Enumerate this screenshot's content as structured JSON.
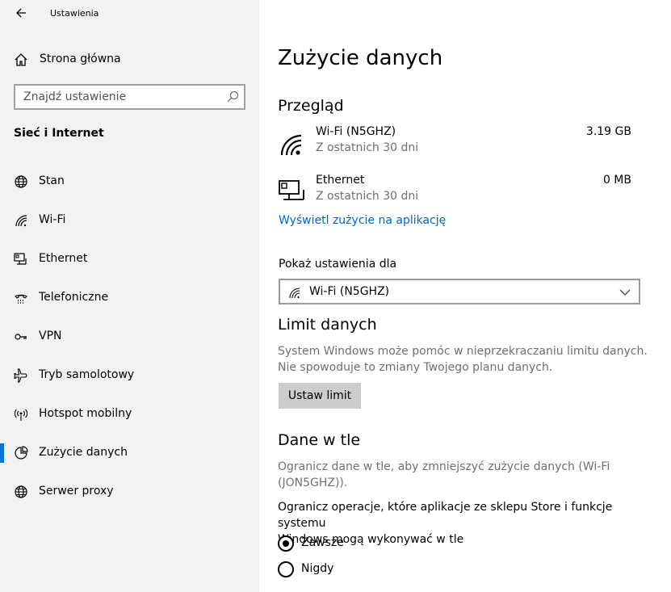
{
  "app": {
    "title": "Ustawienia"
  },
  "sidebar": {
    "home_label": "Strona główna",
    "search_placeholder": "Znajdź ustawienie",
    "section_title": "Sieć i Internet",
    "items": [
      {
        "label": "Stan",
        "icon": "globe-icon",
        "active": false
      },
      {
        "label": "Wi-Fi",
        "icon": "wifi-icon",
        "active": false
      },
      {
        "label": "Ethernet",
        "icon": "ethernet-icon",
        "active": false
      },
      {
        "label": "Telefoniczne",
        "icon": "dialup-icon",
        "active": false
      },
      {
        "label": "VPN",
        "icon": "vpn-icon",
        "active": false
      },
      {
        "label": "Tryb samolotowy",
        "icon": "airplane-icon",
        "active": false
      },
      {
        "label": "Hotspot mobilny",
        "icon": "hotspot-icon",
        "active": false
      },
      {
        "label": "Zużycie danych",
        "icon": "data-usage-icon",
        "active": true
      },
      {
        "label": "Serwer proxy",
        "icon": "globe-icon",
        "active": false
      }
    ]
  },
  "main": {
    "title": "Zużycie danych",
    "overview": {
      "heading": "Przegląd",
      "rows": [
        {
          "name": "Wi-Fi (N5GHZ)",
          "sub": "Z ostatnich 30 dni",
          "amount": "3.19 GB",
          "icon": "wifi-icon"
        },
        {
          "name": "Ethernet",
          "sub": "Z ostatnich 30 dni",
          "amount": "0 MB",
          "icon": "ethernet-icon"
        }
      ],
      "link": "Wyświetl zużycie na aplikację"
    },
    "show_settings": {
      "label": "Pokaż ustawienia dla",
      "selected": "Wi-Fi (N5GHZ)"
    },
    "limit": {
      "heading": "Limit danych",
      "desc_line1": "System Windows może pomóc w nieprzekraczaniu limitu danych.",
      "desc_line2": "Nie spowoduje to zmiany Twojego planu danych.",
      "button": "Ustaw limit"
    },
    "background": {
      "heading": "Dane w tle",
      "desc_line1": "Ogranicz dane w tle, aby zmniejszyć zużycie danych (Wi-Fi",
      "desc_line2": "(JON5GHZ)).",
      "text_line1": "Ogranicz operacje, które aplikacje ze sklepu Store i funkcje systemu",
      "text_line2": "Windows mogą wykonywać w tle",
      "options": [
        {
          "label": "Zawsze",
          "checked": true
        },
        {
          "label": "Nigdy",
          "checked": false
        }
      ]
    }
  },
  "colors": {
    "accent": "#0078d7",
    "link": "#0067c0",
    "sidebar_bg": "#f2f2f2",
    "button_bg": "#cccccc"
  }
}
